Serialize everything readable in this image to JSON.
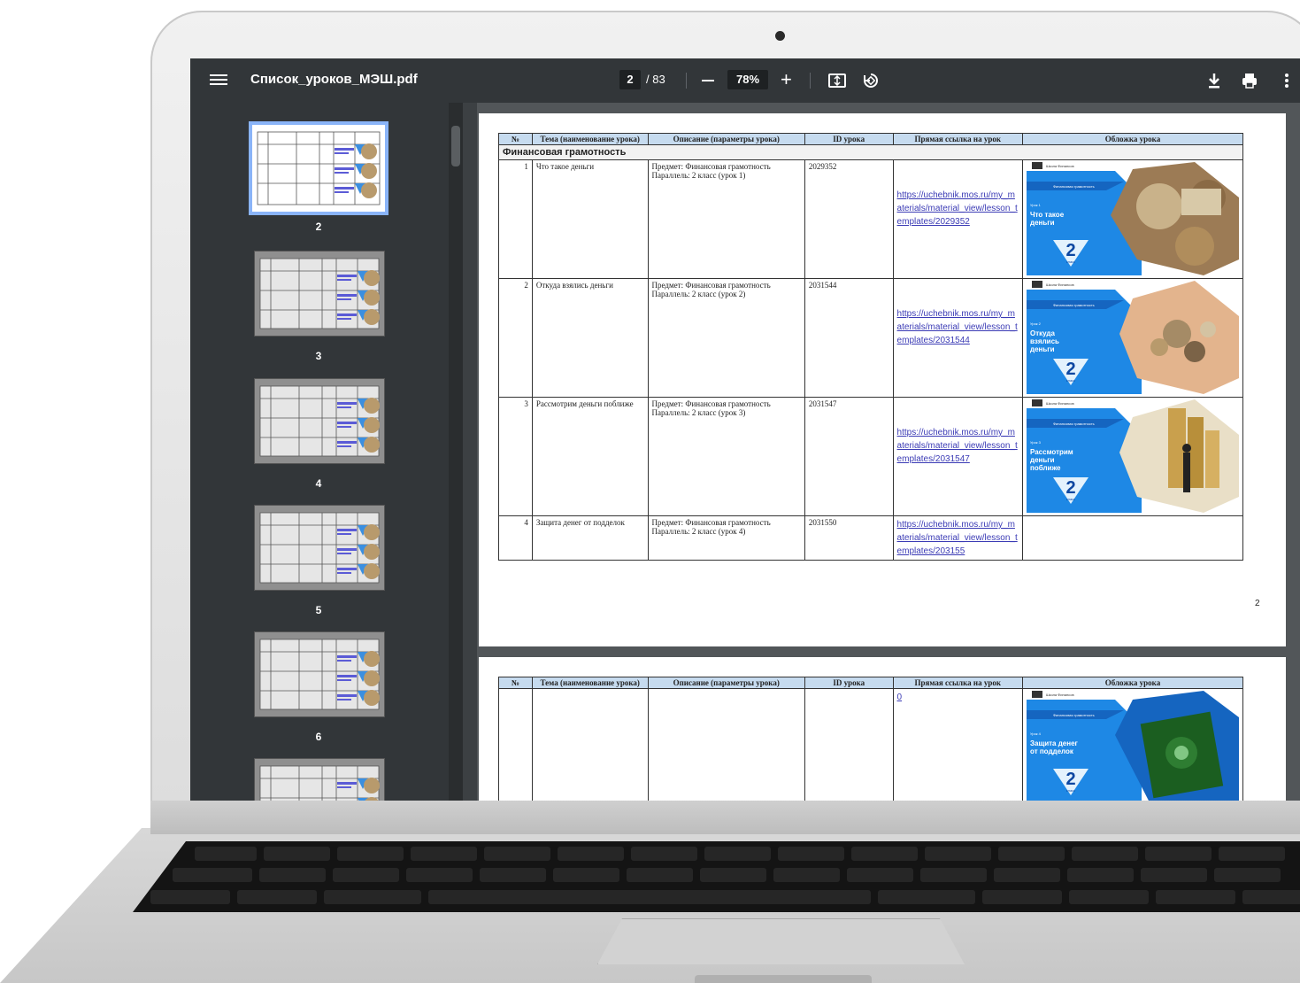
{
  "viewer": {
    "file_name": "Список_уроков_МЭШ.pdf",
    "current_page": "2",
    "total_pages": "/ 83",
    "zoom": "78%"
  },
  "thumbnails": [
    {
      "label": "2",
      "selected": true
    },
    {
      "label": "3",
      "selected": false
    },
    {
      "label": "4",
      "selected": false
    },
    {
      "label": "5",
      "selected": false
    },
    {
      "label": "6",
      "selected": false
    },
    {
      "label": "",
      "selected": false
    }
  ],
  "table_headers": {
    "num": "№",
    "topic": "Тема (наименование урока)",
    "description": "Описание (параметры урока)",
    "id": "ID урока",
    "link": "Прямая ссылка на урок",
    "cover": "Обложка урока"
  },
  "section": "Финансовая грамотность",
  "rows": [
    {
      "num": "1",
      "topic": "Что такое деньги",
      "desc1": "Предмет: Финансовая грамотность",
      "desc2": "Параллель: 2 класс (урок 1)",
      "id": "2029352",
      "link": "https://uchebnik.mos.ru/my_materials/material_view/lesson_templates/2029352",
      "cover_title": "Что такое деньги",
      "cover_grade": "2",
      "cover_grade_label": "класс",
      "cover_header": "Финансовая грамотность",
      "cover_lesson": "Урок 1",
      "cover_org": "Школа Финансов"
    },
    {
      "num": "2",
      "topic": "Откуда взялись деньги",
      "desc1": "Предмет: Финансовая грамотность",
      "desc2": "Параллель: 2 класс (урок 2)",
      "id": "2031544",
      "link": "https://uchebnik.mos.ru/my_materials/material_view/lesson_templates/2031544",
      "cover_title": "Откуда взялись деньги",
      "cover_grade": "2",
      "cover_grade_label": "класс",
      "cover_header": "Финансовая грамотность",
      "cover_lesson": "Урок 2",
      "cover_org": "Школа Финансов"
    },
    {
      "num": "3",
      "topic": "Рассмотрим деньги поближе",
      "desc1": "Предмет: Финансовая грамотность",
      "desc2": "Параллель: 2 класс (урок 3)",
      "id": "2031547",
      "link": "https://uchebnik.mos.ru/my_materials/material_view/lesson_templates/2031547",
      "cover_title": "Рассмотрим деньги поближе",
      "cover_grade": "2",
      "cover_grade_label": "класс",
      "cover_header": "Финансовая грамотность",
      "cover_lesson": "Урок 3",
      "cover_org": "Школа Финансов"
    },
    {
      "num": "4",
      "topic": "Защита денег от подделок",
      "desc1": "Предмет: Финансовая грамотность",
      "desc2": "Параллель: 2 класс (урок 4)",
      "id": "2031550",
      "link": "https://uchebnik.mos.ru/my_materials/material_view/lesson_templates/203155",
      "cover_title": "Защита денег от подделок",
      "cover_grade": "2",
      "cover_grade_label": "класс",
      "cover_header": "Финансовая грамотность",
      "cover_lesson": "Урок 4",
      "cover_org": "Школа Финансов"
    }
  ],
  "page2_number": "2",
  "page3_link_tail": "0",
  "colors": {
    "toolbar": "#323639",
    "viewer_bg": "#525659",
    "header_fill": "#c6dbef",
    "cover_blue": "#1e88e5",
    "link": "#3b3bb5",
    "thumb_selected_border": "#8ab4f8"
  },
  "icons": [
    "menu-icon",
    "download-icon",
    "print-icon",
    "more-vert-icon",
    "fit-page-icon",
    "rotate-icon",
    "camera-icon"
  ]
}
